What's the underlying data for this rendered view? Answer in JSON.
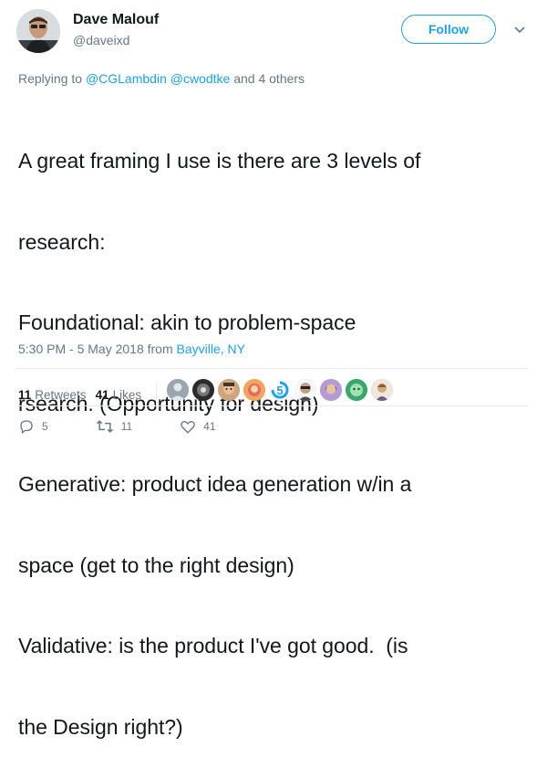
{
  "user": {
    "name": "Dave Malouf",
    "handle": "@daveixd"
  },
  "follow_label": "Follow",
  "reply_context": {
    "prefix": "Replying to ",
    "mentions": [
      "@CGLambdin",
      "@cwodtke"
    ],
    "suffix": " and 4 others"
  },
  "tweet_lines": [
    "A great framing I use is there are 3 levels of",
    "research:",
    "Foundational: akin to problem-space",
    "rsearch. (Opportunity for design)",
    "Generative: product idea generation w/in a",
    "space (get to the right design)",
    "Validative: is the product I've got good.  (is",
    "the Design right?)"
  ],
  "timestamp": "5:30 PM - 5 May 2018 from ",
  "location": "Bayville, NY",
  "stats": {
    "retweets_count": "11",
    "retweets_label": "Retweets",
    "likes_count": "41",
    "likes_label": "Likes"
  },
  "actions": {
    "reply_count": "5",
    "retweet_count": "11",
    "like_count": "41"
  },
  "colors": {
    "accent": "#1da1f2",
    "muted": "#657786",
    "text": "#14171a"
  }
}
